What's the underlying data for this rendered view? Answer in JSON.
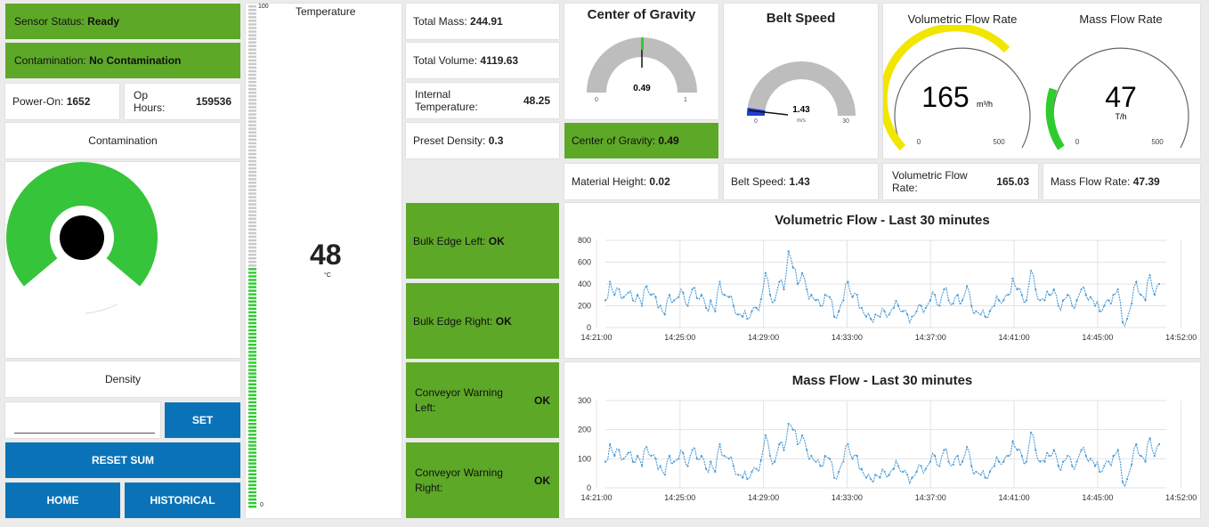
{
  "left": {
    "sensor_status": {
      "label": "Sensor Status:",
      "value": "Ready"
    },
    "contamination_status": {
      "label": "Contamination:",
      "value": "No Contamination"
    },
    "power_on": {
      "label": "Power-On:",
      "value": "1652"
    },
    "op_hours": {
      "label": "Op Hours:",
      "value": "159536"
    },
    "contamination_title": "Contamination",
    "density_title": "Density",
    "density_input": {
      "value": "",
      "placeholder": ""
    },
    "set_button": "SET",
    "reset_button": "RESET SUM",
    "home_button": "HOME",
    "historical_button": "HISTORICAL"
  },
  "temperature": {
    "title": "Temperature",
    "value": "48",
    "unit": "°C",
    "scale_max": "100",
    "scale_min": "0",
    "level": 0.48
  },
  "metrics": {
    "total_mass": {
      "label": "Total Mass:",
      "value": "244.91"
    },
    "total_volume": {
      "label": "Total Volume:",
      "value": "4119.63"
    },
    "internal_temperature": {
      "label": "Internal Temperature:",
      "value": "48.25"
    },
    "preset_density": {
      "label": "Preset Density:",
      "value": "0.3"
    }
  },
  "edges": {
    "bulk_edge_left": {
      "label": "Bulk Edge Left:",
      "value": "OK"
    },
    "bulk_edge_right": {
      "label": "Bulk Edge Right:",
      "value": "OK"
    },
    "conveyor_warning_left": {
      "label": "Conveyor Warning Left:",
      "value": "OK"
    },
    "conveyor_warning_right": {
      "label": "Conveyor Warning Right:",
      "value": "OK"
    }
  },
  "gauges": {
    "cog": {
      "title": "Center of Gravity",
      "value": "0.49",
      "min": "0",
      "max": "1",
      "fraction": 0.49
    },
    "belt": {
      "title": "Belt Speed",
      "value": "1.43",
      "unit": "m/s",
      "min": "0",
      "max": "30",
      "fraction": 0.048
    },
    "vol": {
      "title": "Volumetric Flow Rate",
      "value": "165",
      "unit": "m³/h",
      "min": "0",
      "max": "500",
      "fraction": 0.33
    },
    "mass": {
      "title": "Mass Flow Rate",
      "value": "47",
      "unit": "T/h",
      "min": "0",
      "max": "500",
      "fraction": 0.094
    }
  },
  "readouts": {
    "cog": {
      "label": "Center of Gravity:",
      "value": "0.49"
    },
    "material_height": {
      "label": "Material Height:",
      "value": "0.02"
    },
    "belt_speed": {
      "label": "Belt Speed:",
      "value": "1.43"
    },
    "vol_flow": {
      "label": "Volumetric Flow Rate:",
      "value": "165.03"
    },
    "mass_flow": {
      "label": "Mass Flow Rate:",
      "value": "47.39"
    }
  },
  "colors": {
    "status_green": "#5ea828",
    "button_blue": "#0a73b8",
    "gauge_yellow": "#f2e600",
    "gauge_green": "#2ecc2e",
    "series_blue": "#4a9bd4"
  },
  "chart_data": [
    {
      "type": "line",
      "title": "Volumetric Flow - Last 30 minutes",
      "x_ticks": [
        "14:21:00",
        "14:25:00",
        "14:29:00",
        "14:33:00",
        "14:37:00",
        "14:41:00",
        "14:45:00",
        "14:52:00"
      ],
      "y_ticks": [
        "800",
        "600",
        "400",
        "200",
        "0"
      ],
      "ylim": [
        0,
        800
      ],
      "series": [
        {
          "values": [
            250,
            420,
            300,
            350,
            280,
            320,
            250,
            300,
            200,
            380,
            300,
            280,
            200,
            120,
            300,
            250,
            280,
            320,
            200,
            350,
            270,
            300,
            180,
            250,
            150,
            420,
            300,
            280,
            200,
            120,
            100,
            80,
            150,
            180,
            260,
            500,
            300,
            250,
            420,
            350,
            700,
            550,
            400,
            500,
            350,
            300,
            250,
            200,
            300,
            280,
            100,
            150,
            250,
            420,
            280,
            300,
            180,
            100,
            80,
            120,
            100,
            150,
            120,
            180,
            200,
            150,
            120,
            100,
            150,
            200,
            180,
            250,
            300,
            200,
            350,
            250,
            220,
            300,
            250,
            380,
            200,
            150,
            120,
            100,
            150,
            200,
            250,
            250,
            300,
            450,
            350,
            300,
            250,
            520,
            350,
            250,
            250,
            300,
            350,
            200,
            250,
            300,
            200,
            250,
            350,
            300,
            280,
            200,
            150,
            200,
            250,
            300,
            350,
            50,
            80,
            220,
            420,
            300,
            250,
            480,
            300,
            400
          ]
        }
      ]
    },
    {
      "type": "line",
      "title": "Mass Flow - Last 30 minutes",
      "x_ticks": [
        "14:21:00",
        "14:25:00",
        "14:29:00",
        "14:33:00",
        "14:37:00",
        "14:41:00",
        "14:45:00",
        "14:52:00"
      ],
      "y_ticks": [
        "300",
        "200",
        "100",
        "0"
      ],
      "ylim": [
        0,
        300
      ],
      "series": [
        {
          "values": [
            90,
            150,
            110,
            130,
            100,
            120,
            90,
            110,
            75,
            140,
            110,
            100,
            75,
            45,
            110,
            90,
            100,
            120,
            75,
            130,
            100,
            110,
            65,
            90,
            55,
            150,
            110,
            100,
            75,
            45,
            35,
            30,
            55,
            65,
            95,
            180,
            110,
            90,
            150,
            130,
            220,
            200,
            150,
            180,
            130,
            110,
            90,
            75,
            110,
            100,
            35,
            55,
            90,
            150,
            100,
            110,
            65,
            35,
            30,
            45,
            35,
            55,
            45,
            65,
            75,
            55,
            45,
            35,
            55,
            75,
            65,
            90,
            110,
            75,
            130,
            90,
            80,
            110,
            90,
            140,
            75,
            55,
            45,
            35,
            55,
            75,
            90,
            90,
            110,
            160,
            130,
            110,
            90,
            190,
            130,
            90,
            90,
            110,
            130,
            75,
            90,
            110,
            75,
            90,
            130,
            110,
            100,
            75,
            55,
            75,
            90,
            110,
            130,
            20,
            30,
            80,
            150,
            110,
            90,
            170,
            110,
            150
          ]
        }
      ]
    }
  ]
}
